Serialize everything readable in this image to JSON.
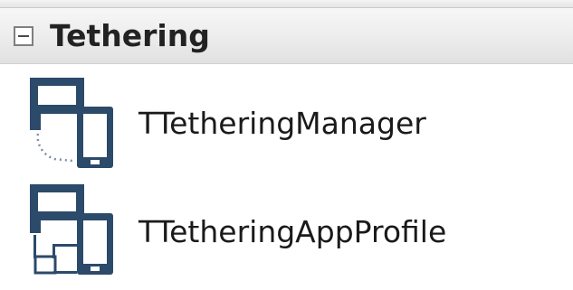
{
  "category": {
    "title": "Tethering",
    "state": "expanded",
    "toggle_icon": "collapse-minus-icon"
  },
  "components": [
    {
      "label": "TTetheringManager",
      "icon": "tethering-manager-icon"
    },
    {
      "label": "TTetheringAppProfile",
      "icon": "tethering-app-profile-icon"
    }
  ],
  "colors": {
    "icon_fill": "#2c4a6a",
    "header_bg": "#ececec",
    "text": "#1a1a1a"
  }
}
